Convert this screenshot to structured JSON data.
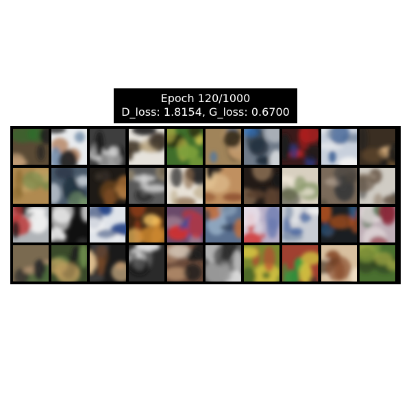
{
  "figure": {
    "title_line1": "Epoch 120/1000",
    "title_line2": "D_loss: 1.8154, G_loss: 0.6700"
  },
  "grid": {
    "rows": 4,
    "cols": 10,
    "samples": [
      {
        "bg": "#5a4a35",
        "a": "#2f6b2a",
        "b": "#c9a37a",
        "c": "#1d1d1d"
      },
      {
        "bg": "#e9ecef",
        "a": "#2a2a2a",
        "b": "#b88a6a",
        "c": "#6f8aa8"
      },
      {
        "bg": "#3e3e3e",
        "a": "#d8d8d8",
        "b": "#8a8a8a",
        "c": "#1a1a1a"
      },
      {
        "bg": "#e6e3dc",
        "a": "#3a2e22",
        "b": "#b7a27c",
        "c": "#1c1c1c"
      },
      {
        "bg": "#3f6e2b",
        "a": "#c9c04a",
        "b": "#2a2a12",
        "c": "#7ea03a"
      },
      {
        "bg": "#a0845a",
        "a": "#5a7a9a",
        "b": "#c9a070",
        "c": "#3b3020"
      },
      {
        "bg": "#6f7a88",
        "a": "#1f2b3a",
        "b": "#3a78c0",
        "c": "#d0d4d8"
      },
      {
        "bg": "#3a1a1a",
        "a": "#b02020",
        "b": "#2a3a8a",
        "c": "#1a1a1a"
      },
      {
        "bg": "#c8d0dc",
        "a": "#f2f2f2",
        "b": "#4a6a9a",
        "c": "#7a8aa0"
      },
      {
        "bg": "#3a2e22",
        "a": "#1a1a1a",
        "b": "#d8b080",
        "c": "#6a5030"
      },
      {
        "bg": "#b08a50",
        "a": "#8a6a30",
        "b": "#d0b070",
        "c": "#6a8a4a"
      },
      {
        "bg": "#4a5a6a",
        "a": "#1a2a3a",
        "b": "#c8d0d8",
        "c": "#7a9a6a"
      },
      {
        "bg": "#1e1a16",
        "a": "#7a4a20",
        "b": "#3a3028",
        "c": "#b07a40"
      },
      {
        "bg": "#5a5a5a",
        "a": "#d8d8d8",
        "b": "#1a1a1a",
        "c": "#a09070"
      },
      {
        "bg": "#e8e2d8",
        "a": "#2a2a2a",
        "b": "#8a6a4a",
        "c": "#c0b090"
      },
      {
        "bg": "#c09060",
        "a": "#1a1a1a",
        "b": "#8a4a2a",
        "c": "#e0c090"
      },
      {
        "bg": "#221a16",
        "a": "#5a4030",
        "b": "#1a1a1a",
        "c": "#a08060"
      },
      {
        "bg": "#d8d0c0",
        "a": "#8a9a6a",
        "b": "#4a4a3a",
        "c": "#f0e8d8"
      },
      {
        "bg": "#7a6a5a",
        "a": "#3a3a3a",
        "b": "#b0a090",
        "c": "#5a5040"
      },
      {
        "bg": "#d0ccc4",
        "a": "#6a5a4a",
        "b": "#a09080",
        "c": "#3a3a3a"
      },
      {
        "bg": "#b0b4b8",
        "a": "#1a1a1a",
        "b": "#f0f0f0",
        "c": "#c03030"
      },
      {
        "bg": "#101010",
        "a": "#f8f8f8",
        "b": "#3a3a3a",
        "c": "#d8d8d8"
      },
      {
        "bg": "#e0e4ea",
        "a": "#2a4a8a",
        "b": "#f4f4f4",
        "c": "#6a7a9a"
      },
      {
        "bg": "#3a2414",
        "a": "#d08a30",
        "b": "#8a3a1a",
        "c": "#f0c060"
      },
      {
        "bg": "#6a4a6a",
        "a": "#d03030",
        "b": "#3a4aa0",
        "c": "#a08090"
      },
      {
        "bg": "#5a7090",
        "a": "#2a3a50",
        "b": "#90a8c0",
        "c": "#c07040"
      },
      {
        "bg": "#b8b0c8",
        "a": "#d04040",
        "b": "#6a7ab0",
        "c": "#e8e0e8"
      },
      {
        "bg": "#c8ccd4",
        "a": "#3a5a9a",
        "b": "#f0f0f0",
        "c": "#8a9ab0"
      },
      {
        "bg": "#1a1e22",
        "a": "#b05020",
        "b": "#2a5a8a",
        "c": "#3a2a1a"
      },
      {
        "bg": "#c0b0b8",
        "a": "#8a2a3a",
        "b": "#e8e0e0",
        "c": "#5a7a5a"
      },
      {
        "bg": "#7a6a50",
        "a": "#4a6a3a",
        "b": "#b09070",
        "c": "#2a2a2a"
      },
      {
        "bg": "#3a4a2a",
        "a": "#c0a060",
        "b": "#1a1a1a",
        "c": "#6a8a4a"
      },
      {
        "bg": "#1a1a1a",
        "a": "#7a4a2a",
        "b": "#e0c090",
        "c": "#3a3a3a"
      },
      {
        "bg": "#2a2a2a",
        "a": "#f0f0f0",
        "b": "#6a6a6a",
        "c": "#101010"
      },
      {
        "bg": "#6a4a3a",
        "a": "#1a1a1a",
        "b": "#b08a6a",
        "c": "#d0c0b0"
      },
      {
        "bg": "#5a5a5a",
        "a": "#e8e8e8",
        "b": "#2a2a2a",
        "c": "#9a9a9a"
      },
      {
        "bg": "#7a8a30",
        "a": "#d0c040",
        "b": "#3a5a20",
        "c": "#c04030"
      },
      {
        "bg": "#a04030",
        "a": "#30a040",
        "b": "#d0c040",
        "c": "#2a2a2a"
      },
      {
        "bg": "#d8c0a0",
        "a": "#8a5030",
        "b": "#f0e0c8",
        "c": "#3a2a1a"
      },
      {
        "bg": "#4a7030",
        "a": "#c0c050",
        "b": "#2a3a1a",
        "c": "#8aa040"
      }
    ]
  }
}
